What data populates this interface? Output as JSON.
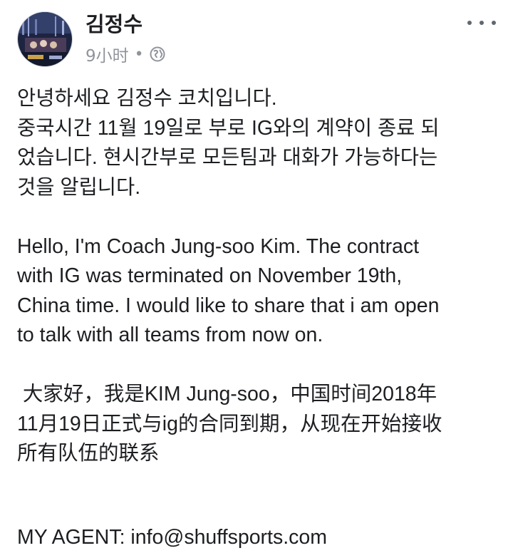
{
  "post": {
    "author": "김정수",
    "time": "9小时",
    "separator": "•",
    "privacy_icon": "globe-icon",
    "more_icon": "more-horizontal-icon"
  },
  "body": {
    "korean": [
      "안녕하세요 김정수 코치입니다.",
      "중국시간 11월 19일로 부로 IG와의 계약이 종료 되",
      "었습니다. 현시간부로 모든팀과 대화가 가능하다는",
      "것을 알립니다."
    ],
    "english": [
      "Hello, I'm Coach Jung-soo Kim. The contract",
      "with IG was terminated on November 19th,",
      "China time. I would like to share that i am open",
      "to talk with all teams from now on."
    ],
    "chinese": [
      " 大家好，我是KIM Jung-soo，中国时间2018年",
      "11月19日正式与ig的合同到期，从现在开始接收",
      "所有队伍的联系"
    ],
    "agent": "MY AGENT: info@shuffsports.com"
  },
  "colors": {
    "text": "#1c1e21",
    "meta": "#90949c"
  }
}
